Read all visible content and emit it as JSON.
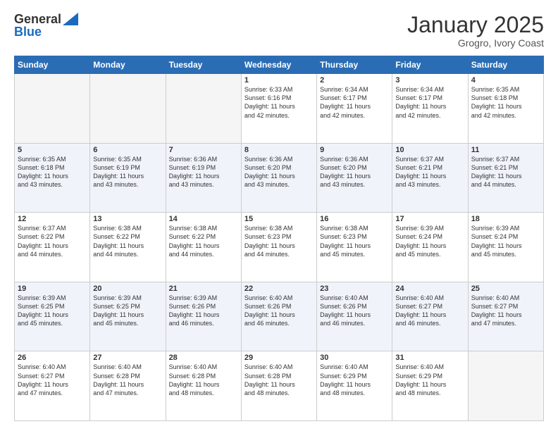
{
  "header": {
    "logo_general": "General",
    "logo_blue": "Blue",
    "month_title": "January 2025",
    "location": "Grogro, Ivory Coast"
  },
  "days_of_week": [
    "Sunday",
    "Monday",
    "Tuesday",
    "Wednesday",
    "Thursday",
    "Friday",
    "Saturday"
  ],
  "weeks": [
    {
      "row_class": "row-white",
      "days": [
        {
          "num": "",
          "info": "",
          "empty": true
        },
        {
          "num": "",
          "info": "",
          "empty": true
        },
        {
          "num": "",
          "info": "",
          "empty": true
        },
        {
          "num": "1",
          "info": "Sunrise: 6:33 AM\nSunset: 6:16 PM\nDaylight: 11 hours\nand 42 minutes.",
          "empty": false
        },
        {
          "num": "2",
          "info": "Sunrise: 6:34 AM\nSunset: 6:17 PM\nDaylight: 11 hours\nand 42 minutes.",
          "empty": false
        },
        {
          "num": "3",
          "info": "Sunrise: 6:34 AM\nSunset: 6:17 PM\nDaylight: 11 hours\nand 42 minutes.",
          "empty": false
        },
        {
          "num": "4",
          "info": "Sunrise: 6:35 AM\nSunset: 6:18 PM\nDaylight: 11 hours\nand 42 minutes.",
          "empty": false
        }
      ]
    },
    {
      "row_class": "row-blue",
      "days": [
        {
          "num": "5",
          "info": "Sunrise: 6:35 AM\nSunset: 6:18 PM\nDaylight: 11 hours\nand 43 minutes.",
          "empty": false
        },
        {
          "num": "6",
          "info": "Sunrise: 6:35 AM\nSunset: 6:19 PM\nDaylight: 11 hours\nand 43 minutes.",
          "empty": false
        },
        {
          "num": "7",
          "info": "Sunrise: 6:36 AM\nSunset: 6:19 PM\nDaylight: 11 hours\nand 43 minutes.",
          "empty": false
        },
        {
          "num": "8",
          "info": "Sunrise: 6:36 AM\nSunset: 6:20 PM\nDaylight: 11 hours\nand 43 minutes.",
          "empty": false
        },
        {
          "num": "9",
          "info": "Sunrise: 6:36 AM\nSunset: 6:20 PM\nDaylight: 11 hours\nand 43 minutes.",
          "empty": false
        },
        {
          "num": "10",
          "info": "Sunrise: 6:37 AM\nSunset: 6:21 PM\nDaylight: 11 hours\nand 43 minutes.",
          "empty": false
        },
        {
          "num": "11",
          "info": "Sunrise: 6:37 AM\nSunset: 6:21 PM\nDaylight: 11 hours\nand 44 minutes.",
          "empty": false
        }
      ]
    },
    {
      "row_class": "row-white",
      "days": [
        {
          "num": "12",
          "info": "Sunrise: 6:37 AM\nSunset: 6:22 PM\nDaylight: 11 hours\nand 44 minutes.",
          "empty": false
        },
        {
          "num": "13",
          "info": "Sunrise: 6:38 AM\nSunset: 6:22 PM\nDaylight: 11 hours\nand 44 minutes.",
          "empty": false
        },
        {
          "num": "14",
          "info": "Sunrise: 6:38 AM\nSunset: 6:22 PM\nDaylight: 11 hours\nand 44 minutes.",
          "empty": false
        },
        {
          "num": "15",
          "info": "Sunrise: 6:38 AM\nSunset: 6:23 PM\nDaylight: 11 hours\nand 44 minutes.",
          "empty": false
        },
        {
          "num": "16",
          "info": "Sunrise: 6:38 AM\nSunset: 6:23 PM\nDaylight: 11 hours\nand 45 minutes.",
          "empty": false
        },
        {
          "num": "17",
          "info": "Sunrise: 6:39 AM\nSunset: 6:24 PM\nDaylight: 11 hours\nand 45 minutes.",
          "empty": false
        },
        {
          "num": "18",
          "info": "Sunrise: 6:39 AM\nSunset: 6:24 PM\nDaylight: 11 hours\nand 45 minutes.",
          "empty": false
        }
      ]
    },
    {
      "row_class": "row-blue",
      "days": [
        {
          "num": "19",
          "info": "Sunrise: 6:39 AM\nSunset: 6:25 PM\nDaylight: 11 hours\nand 45 minutes.",
          "empty": false
        },
        {
          "num": "20",
          "info": "Sunrise: 6:39 AM\nSunset: 6:25 PM\nDaylight: 11 hours\nand 45 minutes.",
          "empty": false
        },
        {
          "num": "21",
          "info": "Sunrise: 6:39 AM\nSunset: 6:26 PM\nDaylight: 11 hours\nand 46 minutes.",
          "empty": false
        },
        {
          "num": "22",
          "info": "Sunrise: 6:40 AM\nSunset: 6:26 PM\nDaylight: 11 hours\nand 46 minutes.",
          "empty": false
        },
        {
          "num": "23",
          "info": "Sunrise: 6:40 AM\nSunset: 6:26 PM\nDaylight: 11 hours\nand 46 minutes.",
          "empty": false
        },
        {
          "num": "24",
          "info": "Sunrise: 6:40 AM\nSunset: 6:27 PM\nDaylight: 11 hours\nand 46 minutes.",
          "empty": false
        },
        {
          "num": "25",
          "info": "Sunrise: 6:40 AM\nSunset: 6:27 PM\nDaylight: 11 hours\nand 47 minutes.",
          "empty": false
        }
      ]
    },
    {
      "row_class": "row-white",
      "days": [
        {
          "num": "26",
          "info": "Sunrise: 6:40 AM\nSunset: 6:27 PM\nDaylight: 11 hours\nand 47 minutes.",
          "empty": false
        },
        {
          "num": "27",
          "info": "Sunrise: 6:40 AM\nSunset: 6:28 PM\nDaylight: 11 hours\nand 47 minutes.",
          "empty": false
        },
        {
          "num": "28",
          "info": "Sunrise: 6:40 AM\nSunset: 6:28 PM\nDaylight: 11 hours\nand 48 minutes.",
          "empty": false
        },
        {
          "num": "29",
          "info": "Sunrise: 6:40 AM\nSunset: 6:28 PM\nDaylight: 11 hours\nand 48 minutes.",
          "empty": false
        },
        {
          "num": "30",
          "info": "Sunrise: 6:40 AM\nSunset: 6:29 PM\nDaylight: 11 hours\nand 48 minutes.",
          "empty": false
        },
        {
          "num": "31",
          "info": "Sunrise: 6:40 AM\nSunset: 6:29 PM\nDaylight: 11 hours\nand 48 minutes.",
          "empty": false
        },
        {
          "num": "",
          "info": "",
          "empty": true
        }
      ]
    }
  ]
}
